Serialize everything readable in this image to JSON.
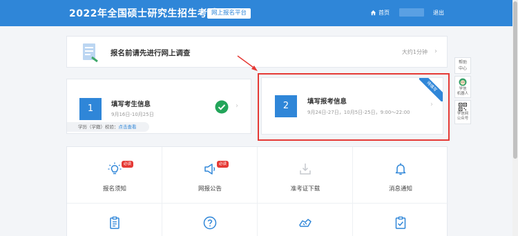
{
  "header": {
    "title": "2022年全国硕士研究生招生考试",
    "platform": "网上报名平台",
    "home": "首页",
    "logout": "退出"
  },
  "survey": {
    "title": "报名前请先进行网上调查",
    "time": "大约1分钟"
  },
  "step1": {
    "number": "1",
    "title": "填写考生信息",
    "dates": "9月16日-10月25日",
    "verify_text": "学历（学籍）校验：",
    "verify_link": "点击查看"
  },
  "step2": {
    "number": "2",
    "title": "填写报考信息",
    "dates": "9月24日-27日，10月5日-25日，9:00～22:00",
    "ribbon": "待填写"
  },
  "side": {
    "help": [
      "帮助",
      "中心"
    ],
    "robot": [
      "学信",
      "机器人"
    ],
    "qr": [
      "学信网",
      "公众号"
    ]
  },
  "grid": {
    "badge": "必读",
    "items": [
      {
        "label": "报名须知",
        "icon": "lightbulb-icon"
      },
      {
        "label": "网报公告",
        "icon": "megaphone-icon"
      },
      {
        "label": "准考证下载",
        "icon": "download-icon"
      },
      {
        "label": "消息通知",
        "icon": "bell-icon"
      },
      {
        "label": "",
        "icon": "clipboard-icon"
      },
      {
        "label": "",
        "icon": "question-icon"
      },
      {
        "label": "",
        "icon": "handshake-icon"
      },
      {
        "label": "",
        "icon": "checklist-icon"
      }
    ]
  },
  "colors": {
    "primary": "#2f86d8",
    "highlight": "#e53935",
    "success": "#23a55a"
  }
}
